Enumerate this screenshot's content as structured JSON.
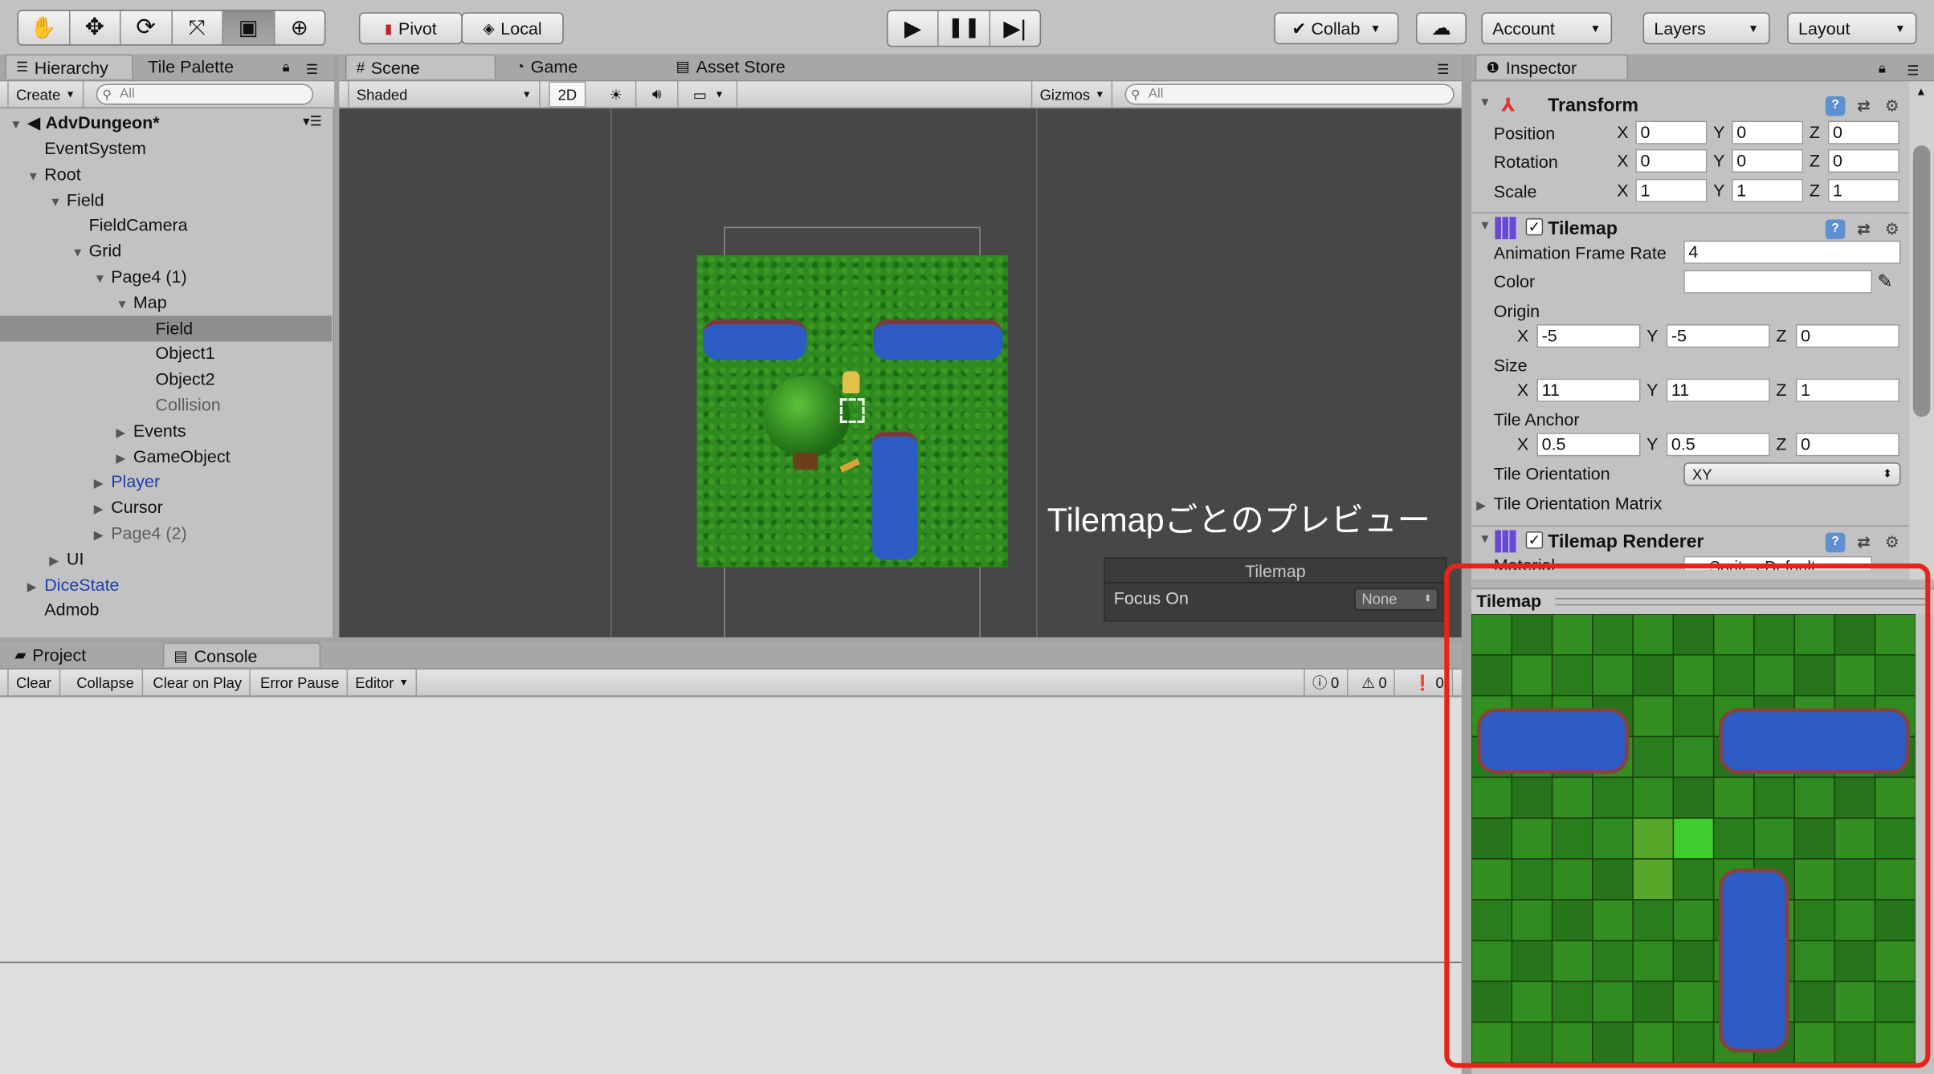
{
  "toolbar": {
    "tools": [
      "hand-tool",
      "move-tool",
      "rotate-tool",
      "scale-tool",
      "rect-tool",
      "transform-tool"
    ],
    "pivot": "Pivot",
    "local": "Local",
    "collab": "Collab",
    "account": "Account",
    "layers": "Layers",
    "layout": "Layout"
  },
  "hierarchy": {
    "tabs": [
      "Hierarchy",
      "Tile Palette"
    ],
    "create": "Create",
    "search_placeholder": "All",
    "scene": "AdvDungeon*",
    "items": [
      {
        "label": "EventSystem",
        "depth": 1,
        "arrow": "",
        "color": "normal"
      },
      {
        "label": "Root",
        "depth": 1,
        "arrow": "down",
        "color": "normal"
      },
      {
        "label": "Field",
        "depth": 2,
        "arrow": "down",
        "color": "normal"
      },
      {
        "label": "FieldCamera",
        "depth": 3,
        "arrow": "",
        "color": "normal"
      },
      {
        "label": "Grid",
        "depth": 3,
        "arrow": "down",
        "color": "normal"
      },
      {
        "label": "Page4 (1)",
        "depth": 4,
        "arrow": "down",
        "color": "normal"
      },
      {
        "label": "Map",
        "depth": 5,
        "arrow": "down",
        "color": "normal"
      },
      {
        "label": "Field",
        "depth": 6,
        "arrow": "",
        "color": "normal",
        "selected": true
      },
      {
        "label": "Object1",
        "depth": 6,
        "arrow": "",
        "color": "normal"
      },
      {
        "label": "Object2",
        "depth": 6,
        "arrow": "",
        "color": "normal"
      },
      {
        "label": "Collision",
        "depth": 6,
        "arrow": "",
        "color": "grey"
      },
      {
        "label": "Events",
        "depth": 5,
        "arrow": "right",
        "color": "normal"
      },
      {
        "label": "GameObject",
        "depth": 5,
        "arrow": "right",
        "color": "normal"
      },
      {
        "label": "Player",
        "depth": 4,
        "arrow": "right",
        "color": "blue"
      },
      {
        "label": "Cursor",
        "depth": 4,
        "arrow": "right",
        "color": "normal"
      },
      {
        "label": "Page4 (2)",
        "depth": 4,
        "arrow": "right",
        "color": "grey"
      },
      {
        "label": "UI",
        "depth": 2,
        "arrow": "right",
        "color": "normal"
      },
      {
        "label": "DiceState",
        "depth": 1,
        "arrow": "right",
        "color": "blue"
      },
      {
        "label": "Admob",
        "depth": 1,
        "arrow": "",
        "color": "normal"
      }
    ]
  },
  "scene": {
    "tabs": [
      "Scene",
      "Game",
      "Asset Store"
    ],
    "shading": "Shaded",
    "mode_2d": "2D",
    "gizmos": "Gizmos",
    "search_placeholder": "All",
    "annotation": "Tilemapごとのプレビュー",
    "overlay_title": "Tilemap",
    "focus_label": "Focus On",
    "focus_value": "None"
  },
  "console": {
    "tabs": [
      "Project",
      "Console"
    ],
    "buttons": [
      "Clear",
      "Collapse",
      "Clear on Play",
      "Error Pause",
      "Editor"
    ],
    "info_count": "0",
    "warn_count": "0",
    "error_count": "0"
  },
  "inspector": {
    "tab": "Inspector",
    "transform": {
      "title": "Transform",
      "position_label": "Position",
      "rotation_label": "Rotation",
      "scale_label": "Scale",
      "position": [
        "0",
        "0",
        "0"
      ],
      "rotation": [
        "0",
        "0",
        "0"
      ],
      "scale": [
        "1",
        "1",
        "1"
      ]
    },
    "tilemap": {
      "title": "Tilemap",
      "frame_rate_label": "Animation Frame Rate",
      "frame_rate": "4",
      "color_label": "Color",
      "origin_label": "Origin",
      "origin": [
        "-5",
        "-5",
        "0"
      ],
      "size_label": "Size",
      "size": [
        "11",
        "11",
        "1"
      ],
      "anchor_label": "Tile Anchor",
      "anchor": [
        "0.5",
        "0.5",
        "0"
      ],
      "orientation_label": "Tile Orientation",
      "orientation": "XY",
      "matrix_label": "Tile Orientation Matrix"
    },
    "renderer": {
      "title": "Tilemap Renderer",
      "material_label": "Material",
      "material_value": "Sprites-Default"
    },
    "preview_title": "Tilemap"
  },
  "colors": {
    "highlight": "#e8221c",
    "grass": "#2f8a1f",
    "water": "#2c5cc4"
  }
}
